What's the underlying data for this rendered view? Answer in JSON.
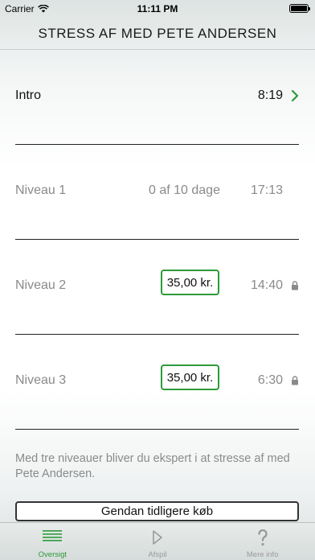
{
  "status_bar": {
    "carrier": "Carrier",
    "time": "11:11 PM",
    "battery_level": 1.0
  },
  "header": {
    "title": "STRESS AF MED PETE ANDERSEN"
  },
  "levels": [
    {
      "name": "Intro",
      "progress": "",
      "duration": "8:19",
      "price": "",
      "state": "available"
    },
    {
      "name": "Niveau 1",
      "progress": "0 af 10 dage",
      "duration": "17:13",
      "price": "",
      "state": "available"
    },
    {
      "name": "Niveau 2",
      "progress": "",
      "duration": "14:40",
      "price": "35,00 kr.",
      "state": "locked"
    },
    {
      "name": "Niveau 3",
      "progress": "",
      "duration": "6:30",
      "price": "35,00 kr.",
      "state": "locked"
    }
  ],
  "description": "Med tre niveauer bliver du ekspert i at stresse af med Pete Andersen.",
  "restore_button": "Gendan tidligere køb",
  "tabs": [
    {
      "label": "Oversigt",
      "icon": "list-icon",
      "selected": true
    },
    {
      "label": "Afspil",
      "icon": "play-icon",
      "selected": false
    },
    {
      "label": "Mere info",
      "icon": "question-icon",
      "selected": false
    }
  ],
  "colors": {
    "accent": "#2e9a3a",
    "muted_text": "#8a8a8a",
    "inactive_tab": "#9a9a9a"
  }
}
